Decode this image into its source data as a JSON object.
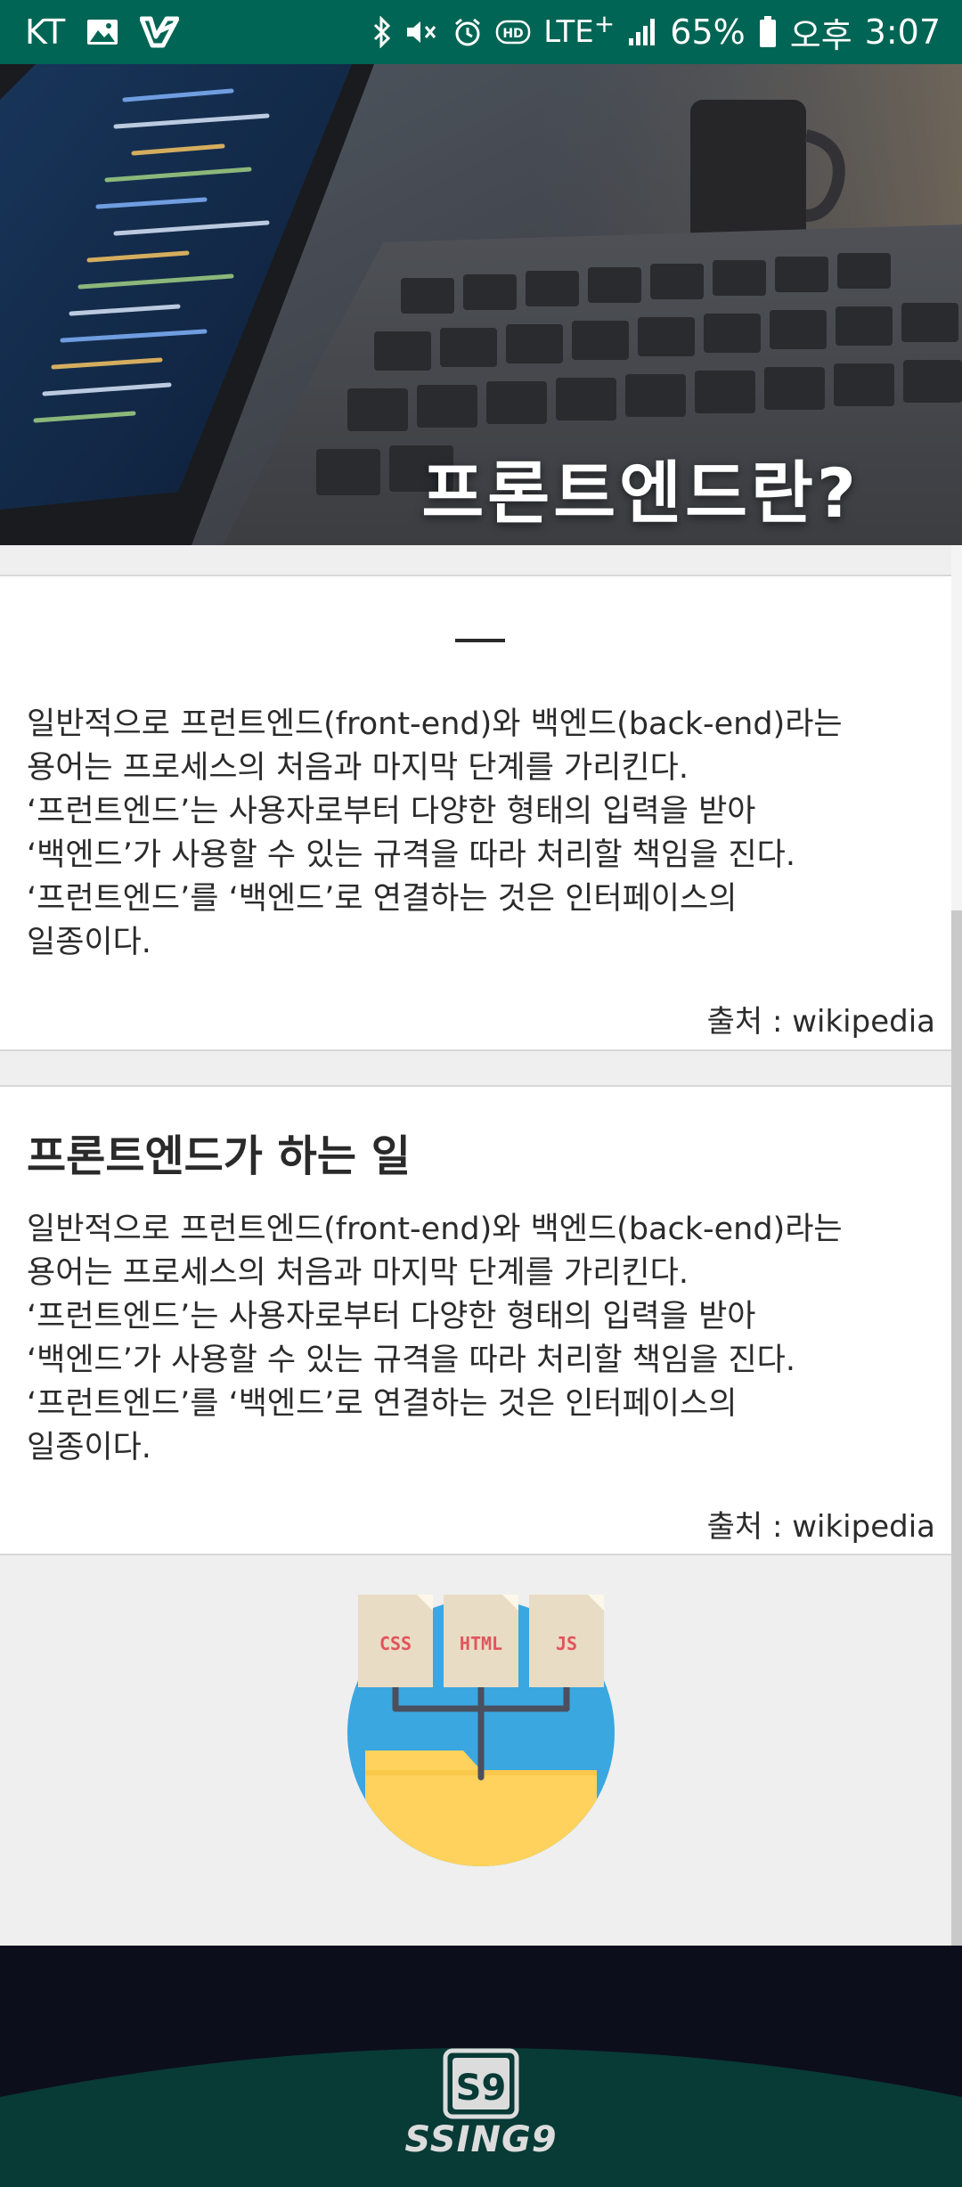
{
  "status_bar": {
    "carrier": "KT",
    "network": "LTE",
    "network_sup": "+",
    "battery": "65%",
    "ampm": "오후",
    "time": "3:07",
    "icons": [
      "image-icon",
      "vimeo-like-icon",
      "bluetooth-icon",
      "mute-icon",
      "alarm-icon",
      "hd-icon",
      "signal-icon",
      "battery-icon"
    ]
  },
  "hero": {
    "title": "프론트엔드란?"
  },
  "section1": {
    "lines": [
      "일반적으로 프런트엔드(front-end)와 백엔드(back-end)라는",
      "용어는 프로세스의 처음과 마지막 단계를 가리킨다.",
      "‘프런트엔드’는 사용자로부터 다양한 형태의 입력을 받아",
      "‘백엔드’가 사용할 수 있는 규격을 따라 처리할 책임을 진다.",
      "‘프런트엔드’를 ‘백엔드’로 연결하는 것은 인터페이스의",
      "일종이다."
    ],
    "source": "출처 : wikipedia"
  },
  "section2": {
    "title": "프론트엔드가 하는 일",
    "lines": [
      "일반적으로 프런트엔드(front-end)와 백엔드(back-end)라는",
      "용어는 프로세스의 처음과 마지막 단계를 가리킨다.",
      "‘프런트엔드’는 사용자로부터 다양한 형태의 입력을 받아",
      "‘백엔드’가 사용할 수 있는 규격을 따라 처리할 책임을 진다.",
      "‘프런트엔드’를 ‘백엔드’로 연결하는 것은 인터페이스의",
      "일종이다."
    ],
    "source": "출처 : wikipedia"
  },
  "illustration": {
    "docs": [
      "CSS",
      "HTML",
      "JS"
    ]
  },
  "footer": {
    "logo_mark": "S9",
    "brand": "SSING9"
  },
  "colors": {
    "status_bar": "#006554",
    "footer_bg": "#0d0e1c",
    "footer_wave": "#083a36",
    "circle": "#3aa7e0",
    "folder": "#fed25c",
    "doc": "#e9dcc4",
    "doc_label": "#e2545c"
  }
}
